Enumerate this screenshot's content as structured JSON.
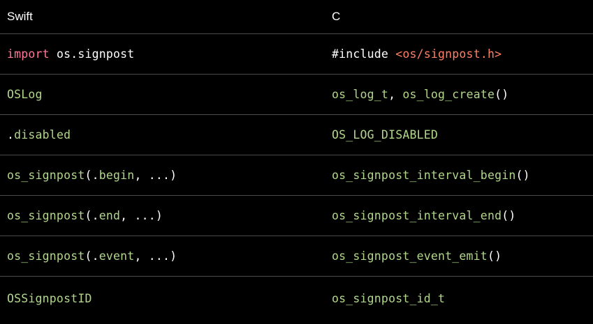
{
  "header": {
    "left": "Swift",
    "right": "C"
  },
  "rows": [
    {
      "left": [
        {
          "t": "import",
          "c": "p"
        },
        {
          "t": " os.signpost",
          "c": "w"
        }
      ],
      "right": [
        {
          "t": "#include ",
          "c": "w"
        },
        {
          "t": "<os/signpost.h>",
          "c": "o"
        }
      ]
    },
    {
      "left": [
        {
          "t": "OSLog",
          "c": "g"
        }
      ],
      "right": [
        {
          "t": "os_log_t",
          "c": "g"
        },
        {
          "t": ", ",
          "c": "w"
        },
        {
          "t": "os_log_create",
          "c": "g"
        },
        {
          "t": "()",
          "c": "w"
        }
      ]
    },
    {
      "left": [
        {
          "t": ".",
          "c": "w"
        },
        {
          "t": "disabled",
          "c": "g"
        }
      ],
      "right": [
        {
          "t": "OS_LOG_DISABLED",
          "c": "g"
        }
      ]
    },
    {
      "left": [
        {
          "t": "os_signpost",
          "c": "g"
        },
        {
          "t": "(.",
          "c": "w"
        },
        {
          "t": "begin",
          "c": "g"
        },
        {
          "t": ", ...)",
          "c": "w"
        }
      ],
      "right": [
        {
          "t": "os_signpost_interval_begin",
          "c": "g"
        },
        {
          "t": "()",
          "c": "w"
        }
      ]
    },
    {
      "left": [
        {
          "t": "os_signpost",
          "c": "g"
        },
        {
          "t": "(.",
          "c": "w"
        },
        {
          "t": "end",
          "c": "g"
        },
        {
          "t": ", ...)",
          "c": "w"
        }
      ],
      "right": [
        {
          "t": "os_signpost_interval_end",
          "c": "g"
        },
        {
          "t": "()",
          "c": "w"
        }
      ]
    },
    {
      "left": [
        {
          "t": "os_signpost",
          "c": "g"
        },
        {
          "t": "(.",
          "c": "w"
        },
        {
          "t": "event",
          "c": "g"
        },
        {
          "t": ", ...)",
          "c": "w"
        }
      ],
      "right": [
        {
          "t": "os_signpost_event_emit",
          "c": "g"
        },
        {
          "t": "()",
          "c": "w"
        }
      ]
    },
    {
      "left": [
        {
          "t": "OSSignpostID",
          "c": "g"
        }
      ],
      "right": [
        {
          "t": "os_signpost_id_t",
          "c": "g"
        }
      ]
    }
  ],
  "colors": {
    "background": "#000000",
    "text": "#ffffff",
    "identifier": "#b2d78a",
    "keyword": "#ff7a9a",
    "include_path": "#ff8066",
    "divider": "#4a4a4a"
  }
}
